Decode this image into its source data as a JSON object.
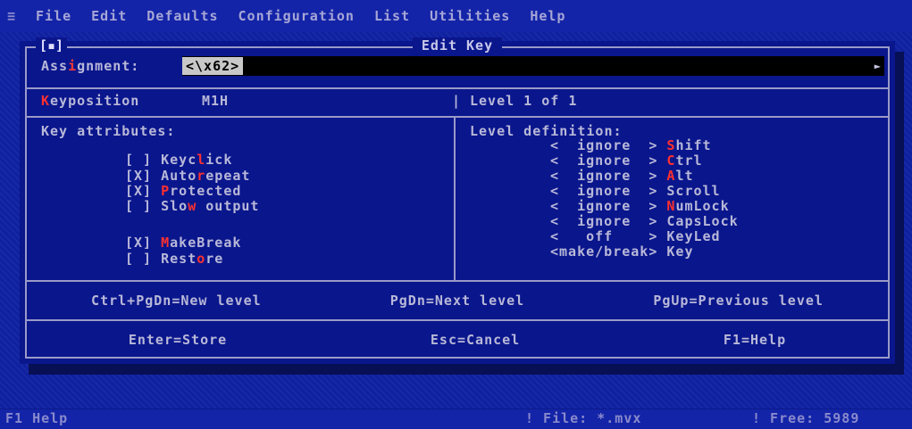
{
  "menubar": {
    "system_icon": "≡",
    "items": [
      "File",
      "Edit",
      "Defaults",
      "Configuration",
      "List",
      "Utilities",
      "Help"
    ]
  },
  "dialog": {
    "title": "Edit Key",
    "close_box": "[▪]",
    "assignment": {
      "label_pre": "Ass",
      "label_hot": "i",
      "label_post": "gnment:",
      "value": "<\\x62>"
    },
    "keyposition": {
      "label_hot": "K",
      "label_rest": "eyposition",
      "value": "M1H"
    },
    "level": "Level 1 of 1",
    "key_attributes_heading": "Key attributes:",
    "attributes": [
      {
        "check": "[ ]",
        "pre": "Keyc",
        "hot": "l",
        "post": "ick"
      },
      {
        "check": "[X]",
        "pre": "Auto",
        "hot": "r",
        "post": "epeat"
      },
      {
        "check": "[X]",
        "pre": "",
        "hot": "P",
        "post": "rotected"
      },
      {
        "check": "[ ]",
        "pre": "Slo",
        "hot": "w",
        "post": " output"
      },
      {
        "check": "[X]",
        "pre": "",
        "hot": "M",
        "post": "akeBreak"
      },
      {
        "check": "[ ]",
        "pre": "Rest",
        "hot": "o",
        "post": "re"
      }
    ],
    "level_definition_heading": "Level definition:",
    "level_defs": [
      {
        "value": "<  ignore  >",
        "hot": "S",
        "post": "hift"
      },
      {
        "value": "<  ignore  >",
        "hot": "C",
        "post": "trl"
      },
      {
        "value": "<  ignore  >",
        "hot": "A",
        "post": "lt"
      },
      {
        "value": "<  ignore  >",
        "hot": "",
        "post": "Scroll"
      },
      {
        "value": "<  ignore  >",
        "hot": "N",
        "post": "umLock"
      },
      {
        "value": "<  ignore  >",
        "hot": "",
        "post": "CapsLock"
      },
      {
        "value": "<   off    >",
        "hot": "",
        "post": "KeyLed"
      },
      {
        "value": "<make/break>",
        "hot": "",
        "post": "Key"
      }
    ],
    "footer1": [
      "Ctrl+PgDn=New level",
      "PgDn=Next level",
      "PgUp=Previous level"
    ],
    "footer2": [
      "Enter=Store",
      "Esc=Cancel",
      "F1=Help"
    ]
  },
  "statusbar": {
    "help": "F1 Help",
    "file": "! File: *.mvx",
    "free": "! Free: 5989"
  }
}
